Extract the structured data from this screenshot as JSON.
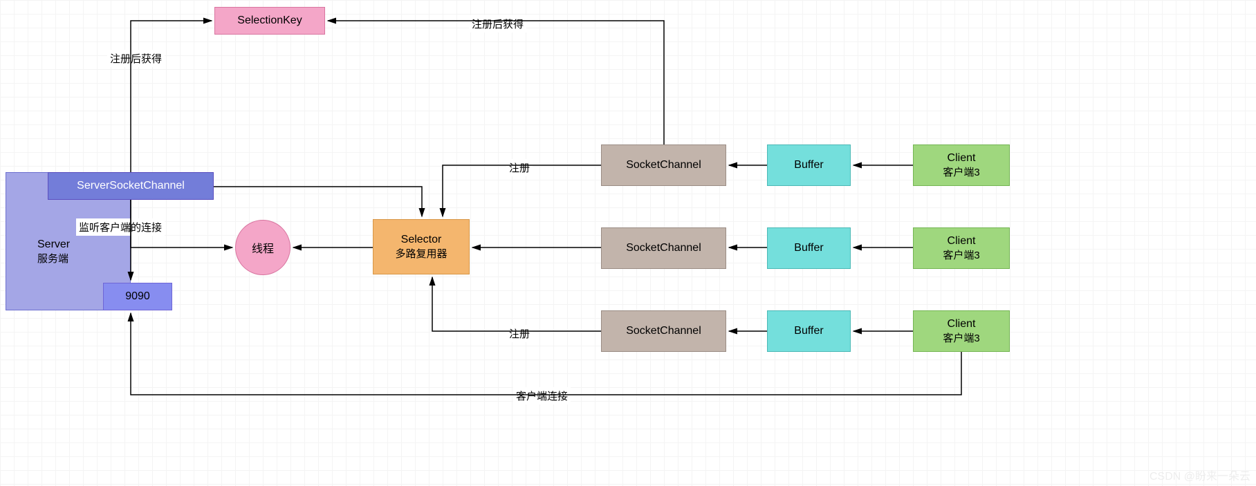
{
  "nodes": {
    "selectionKey": "SelectionKey",
    "serverSocketChannel": "ServerSocketChannel",
    "server_title": "Server",
    "server_sub": "服务端",
    "port": "9090",
    "thread": "线程",
    "selector_title": "Selector",
    "selector_sub": "多路复用器",
    "socketChannel": "SocketChannel",
    "buffer": "Buffer",
    "client_title": "Client",
    "client_sub": "客户端3"
  },
  "edges": {
    "registerGain": "注册后获得",
    "register": "注册",
    "listen": "监听客户端的连接",
    "clientConn": "客户端连接"
  },
  "watermark": "CSDN @盼来一朵云"
}
